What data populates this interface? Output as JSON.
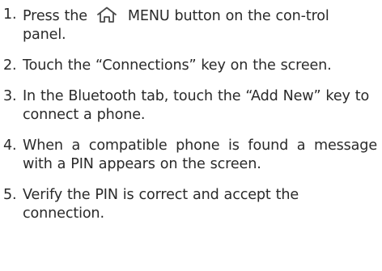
{
  "steps": [
    {
      "number": "1.",
      "before_icon": "Press the",
      "icon": "home-icon",
      "after_icon": "MENU button on the con-trol panel."
    },
    {
      "number": "2.",
      "text": "Touch the “Connections” key on the screen."
    },
    {
      "number": "3.",
      "text": "In the Bluetooth tab, touch the “Add New” key to connect a phone."
    },
    {
      "number": "4.",
      "text": "When a compatible phone is found a message with a PIN appears on the screen."
    },
    {
      "number": "5.",
      "text": "Verify the PIN is correct and accept the connection."
    }
  ]
}
